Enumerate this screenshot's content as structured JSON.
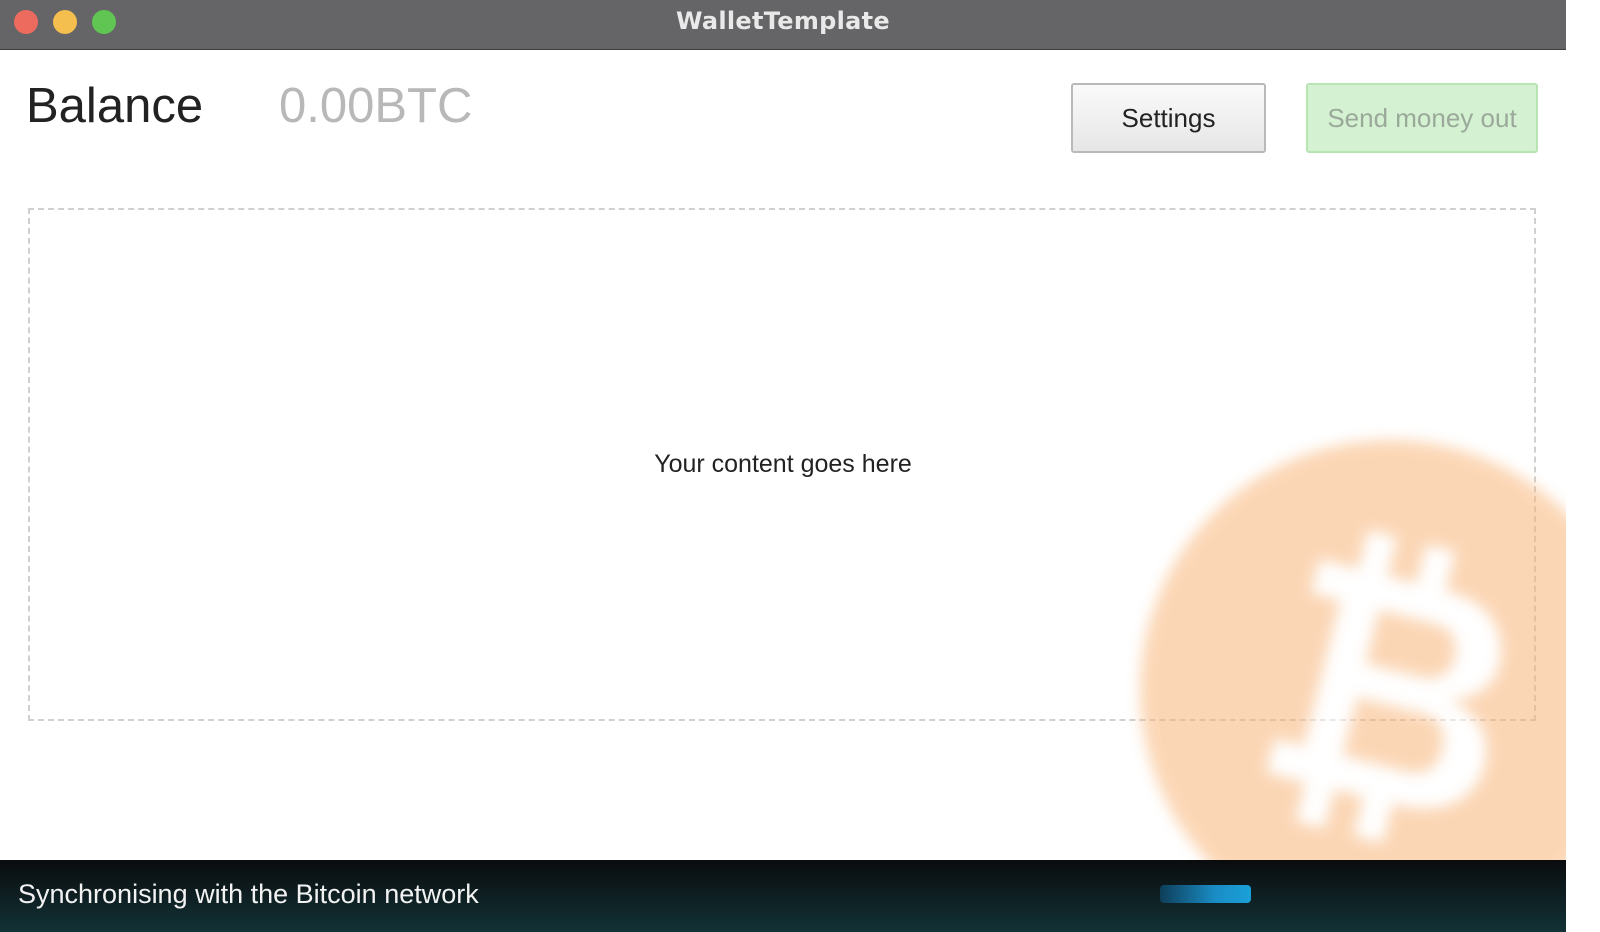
{
  "window": {
    "title": "WalletTemplate"
  },
  "header": {
    "balance_label": "Balance",
    "balance_value": "0.00BTC",
    "settings_label": "Settings",
    "send_label": "Send money out"
  },
  "main": {
    "placeholder": "Your content goes here",
    "background_icon": "bitcoin-logo-icon"
  },
  "status": {
    "text": "Synchronising with the Bitcoin network",
    "progress_state": "indeterminate"
  },
  "colors": {
    "titlebar": "#656567",
    "send_button": "#d4f2d1",
    "bitcoin_orange": "#f7931a",
    "statusbar": "#0a0c0e",
    "progress": "#1a8cc4"
  }
}
